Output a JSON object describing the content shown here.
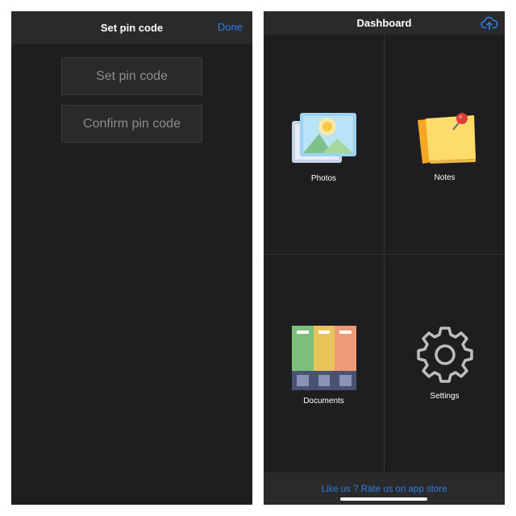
{
  "pin_screen": {
    "title": "Set pin code",
    "done_label": "Done",
    "pin_placeholder": "Set pin code",
    "confirm_placeholder": "Confirm pin code"
  },
  "dashboard": {
    "title": "Dashboard",
    "upload_icon": "cloud-upload-icon",
    "tiles": [
      {
        "label": "Photos",
        "icon": "photos-icon"
      },
      {
        "label": "Notes",
        "icon": "sticky-note-icon"
      },
      {
        "label": "Documents",
        "icon": "folders-icon"
      },
      {
        "label": "Settings",
        "icon": "gear-icon"
      }
    ],
    "footer_link": "Like us ? Rate us on app store"
  },
  "colors": {
    "background": "#1e1e20",
    "bar": "#2a2a2c",
    "accent": "#2f7de1",
    "text": "#ffffff",
    "placeholder": "#8e8e92"
  }
}
